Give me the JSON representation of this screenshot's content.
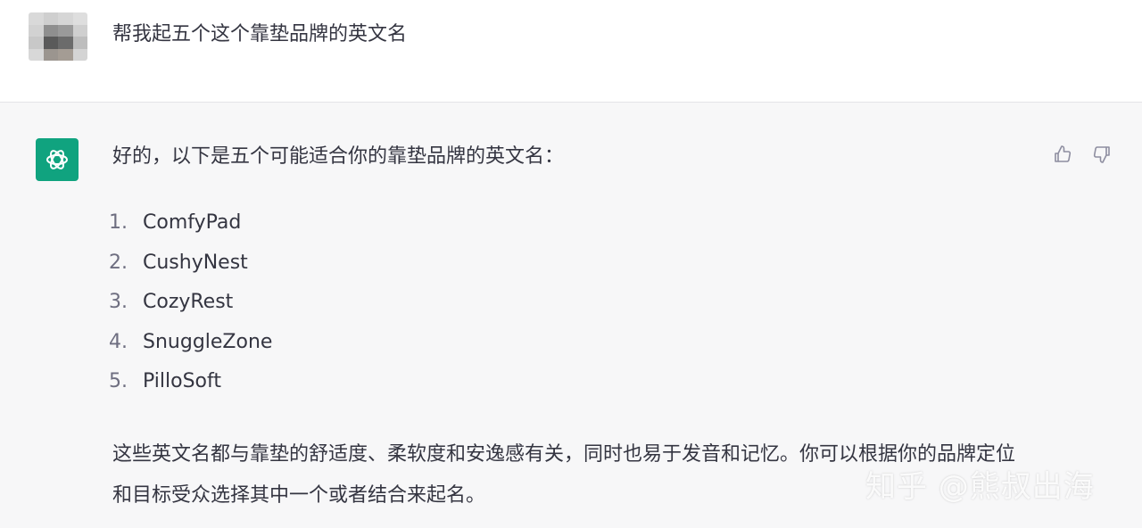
{
  "user_message": {
    "avatar": "blurred-user-avatar",
    "text": "帮我起五个这个靠垫品牌的英文名"
  },
  "assistant_message": {
    "avatar": "openai-logo-icon",
    "avatar_color": "#10a37f",
    "intro": "好的，以下是五个可能适合你的靠垫品牌的英文名：",
    "names": [
      {
        "num": "1.",
        "name": "ComfyPad"
      },
      {
        "num": "2.",
        "name": "CushyNest"
      },
      {
        "num": "3.",
        "name": "CozyRest"
      },
      {
        "num": "4.",
        "name": "SnuggleZone"
      },
      {
        "num": "5.",
        "name": "PilloSoft"
      }
    ],
    "outro": "这些英文名都与靠垫的舒适度、柔软度和安逸感有关，同时也易于发音和记忆。你可以根据你的品牌定位和目标受众选择其中一个或者结合来起名。",
    "feedback": {
      "up_icon": "thumbs-up-icon",
      "down_icon": "thumbs-down-icon"
    }
  },
  "watermark": "知乎 @熊叔出海",
  "colors": {
    "text": "#343541",
    "assistant_bg": "#f7f7f8",
    "accent": "#10a37f"
  }
}
